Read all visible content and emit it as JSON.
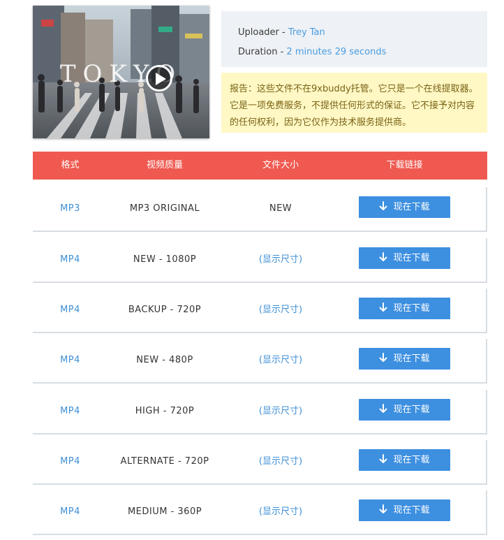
{
  "video": {
    "thumbnail_caption": "TOKYO",
    "play_icon": "play-icon"
  },
  "meta": {
    "uploader_label": "Uploader - ",
    "uploader_value": "Trey Tan",
    "duration_label": "Duration - ",
    "duration_value": "2 minutes 29 seconds"
  },
  "notice": {
    "text": "报告：这些文件不在9xbuddy托管。它只是一个在线提取器。它是一项免费服务，不提供任何形式的保证。它不接予对内容的任何权利，因为它仅作为技术服务提供商。"
  },
  "table": {
    "headers": [
      "格式",
      "视频质量",
      "文件大小",
      "下载链接"
    ],
    "rows": [
      {
        "format": "MP3",
        "quality": "MP3 ORIGINAL",
        "size": "NEW",
        "button": "现在下载"
      },
      {
        "format": "MP4",
        "quality": "NEW - 1080P",
        "size": "(显示尺寸)",
        "button": "现在下载"
      },
      {
        "format": "MP4",
        "quality": "BACKUP - 720P",
        "size": "(显示尺寸)",
        "button": "现在下载"
      },
      {
        "format": "MP4",
        "quality": "NEW - 480P",
        "size": "(显示尺寸)",
        "button": "现在下载"
      },
      {
        "format": "MP4",
        "quality": "HIGH - 720P",
        "size": "(显示尺寸)",
        "button": "现在下载"
      },
      {
        "format": "MP4",
        "quality": "ALTERNATE - 720P",
        "size": "(显示尺寸)",
        "button": "现在下载"
      },
      {
        "format": "MP4",
        "quality": "MEDIUM - 360P",
        "size": "(显示尺寸)",
        "button": "现在下载"
      }
    ]
  },
  "colors": {
    "header_bg": "#ef5950",
    "link_blue": "#3d8fd6",
    "button_blue": "#3d8fe0",
    "notice_bg": "#fff8c4",
    "meta_bg": "#eef1f5"
  }
}
